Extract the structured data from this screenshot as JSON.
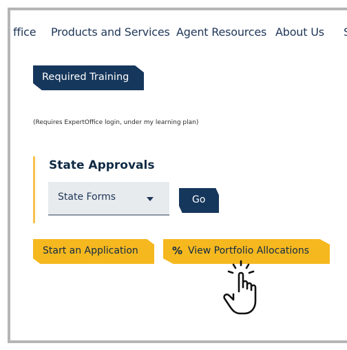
{
  "nav": {
    "items": [
      {
        "label": "ffice"
      },
      {
        "label": "Products and Services"
      },
      {
        "label": "Agent Resources"
      },
      {
        "label": "About Us"
      },
      {
        "label": "S"
      }
    ]
  },
  "training": {
    "button_label": "Required Training",
    "note": "(Requires ExpertOffice login, under my learning plan)"
  },
  "state_approvals": {
    "title": "State Approvals",
    "select_value": "State Forms",
    "go_label": "Go"
  },
  "actions": {
    "start_label": "Start an Application",
    "view_icon": "%",
    "view_label": "View Portfolio Allocations"
  },
  "colors": {
    "navy": "#16375c",
    "yellow": "#f6b81f",
    "accent": "#f6c24a"
  },
  "icons": {
    "cursor": "hand-pointer-click-icon",
    "dropdown": "caret-down-icon"
  }
}
